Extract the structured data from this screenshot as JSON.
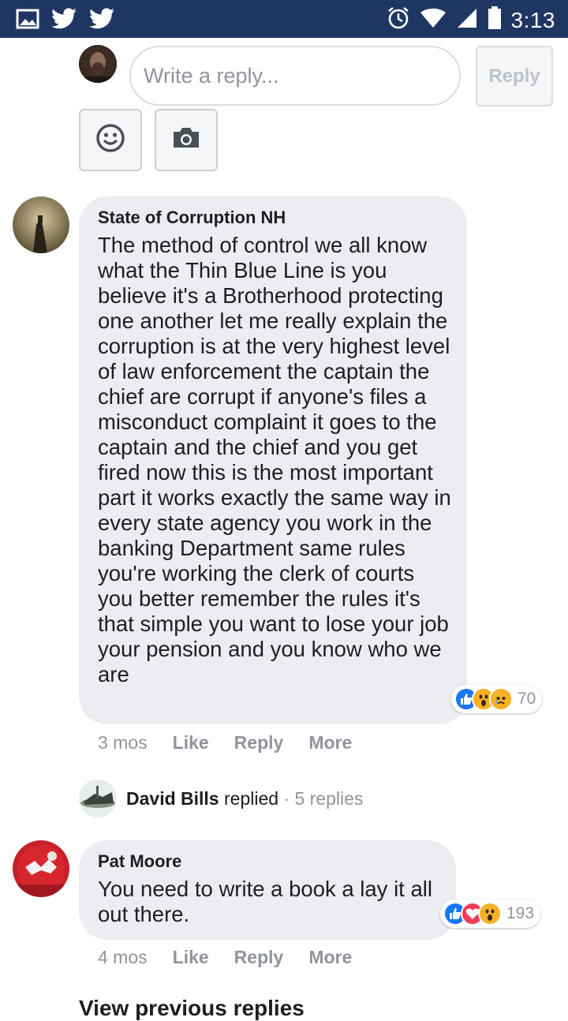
{
  "status_bar": {
    "time": "3:13",
    "icons": [
      "image-icon",
      "twitter-icon",
      "twitter-icon",
      "alarm-icon",
      "wifi-icon",
      "signal-icon",
      "battery-icon"
    ]
  },
  "composer": {
    "placeholder": "Write a reply...",
    "reply_label": "Reply",
    "tools": [
      "emoji-icon",
      "camera-icon"
    ]
  },
  "comments": [
    {
      "author": "State of Corruption NH",
      "text": "The method of control we all know what the Thin Blue Line is you believe it's a Brotherhood protecting one another let me really explain the corruption is at the very highest level of law enforcement the captain the chief are corrupt if anyone's files a misconduct complaint it goes to the captain and the chief and you get fired now this is the most important part it works exactly the same way in every state agency you work in the banking Department same rules you're working the clerk of courts you better remember the rules it's that simple you want to lose your job your pension and you know who we are",
      "time": "3 mos",
      "like": "Like",
      "reply": "Reply",
      "more": "More",
      "reaction_count": "70",
      "reactions": [
        "like",
        "wow",
        "sad"
      ]
    },
    {
      "author": "Pat Moore",
      "text": "You need to write a book a lay it all out there.",
      "time": "4 mos",
      "like": "Like",
      "reply": "Reply",
      "more": "More",
      "reaction_count": "193",
      "reactions": [
        "like",
        "love",
        "wow"
      ]
    }
  ],
  "replied": {
    "name": "David Bills",
    "verb": "replied",
    "separator": "·",
    "count": "5 replies"
  },
  "view_previous": "View previous replies",
  "colors": {
    "status_bar": "#1f3663",
    "bubble": "#ebedf0",
    "like_blue": "#1877f2",
    "love_red": "#f33e58",
    "wow_yellow": "#f7b125"
  }
}
